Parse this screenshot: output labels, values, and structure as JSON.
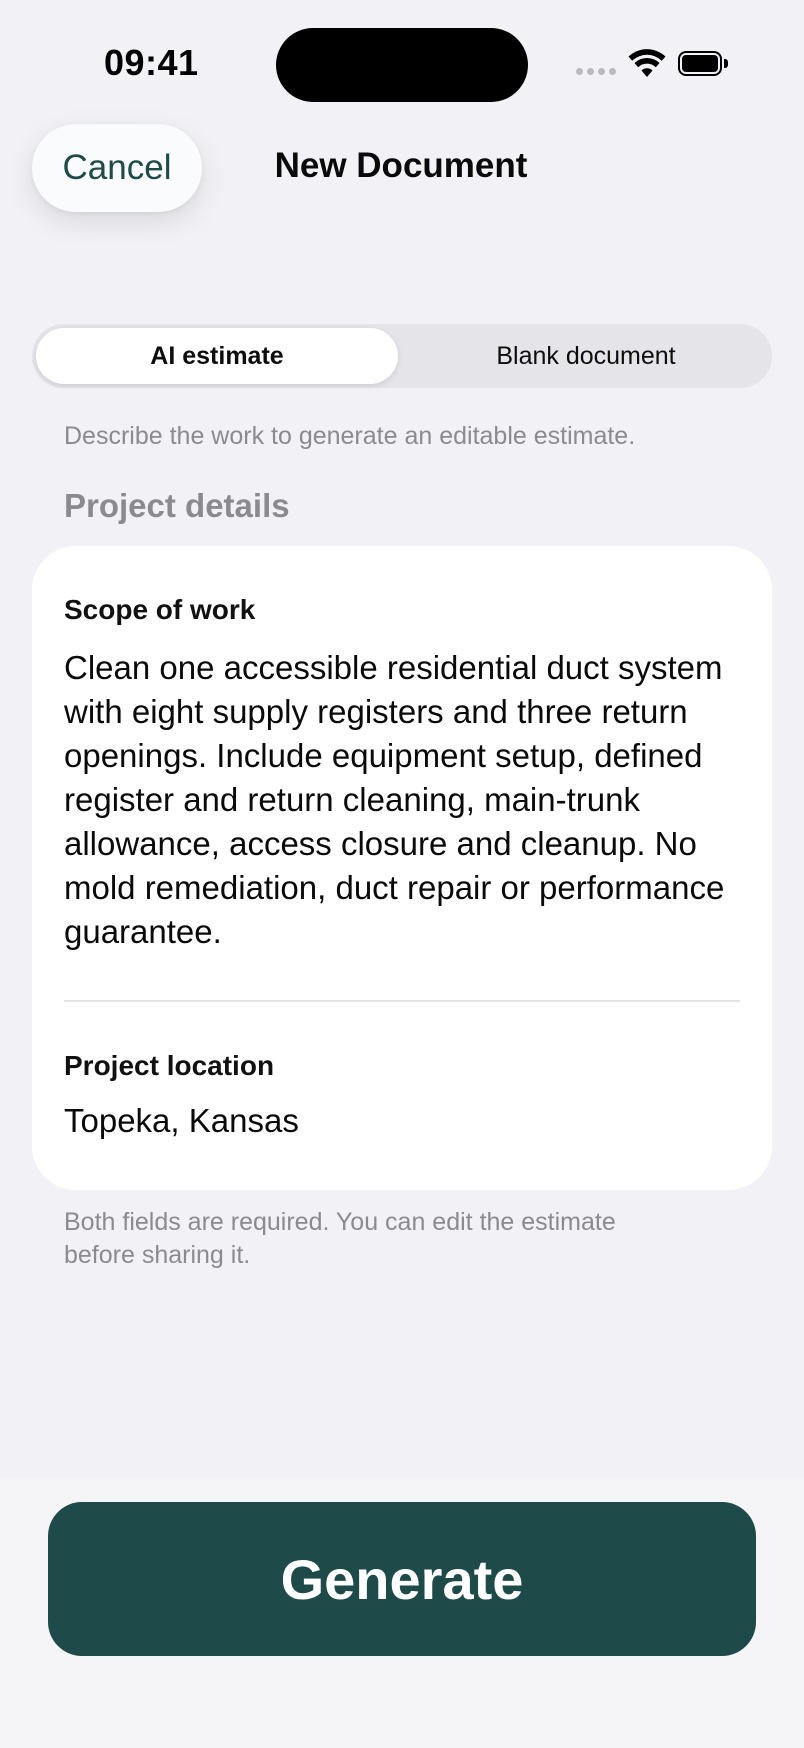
{
  "status_bar": {
    "time": "09:41"
  },
  "nav": {
    "cancel_label": "Cancel",
    "title": "New Document"
  },
  "segmented": {
    "options": [
      "AI estimate",
      "Blank document"
    ],
    "selected": "AI estimate"
  },
  "helper_text": "Describe the work to generate an editable estimate.",
  "section_title": "Project details",
  "form": {
    "scope": {
      "label": "Scope of work",
      "value": "Clean one accessible residential duct system with eight supply registers and three return openings. Include equipment setup, defined register and return cleaning, main-trunk allowance, access closure and cleanup. No mold remediation, duct repair or performance guarantee."
    },
    "location": {
      "label": "Project location",
      "value": "Topeka, Kansas"
    }
  },
  "footnote": "Both fields are required. You can edit the estimate before sharing it.",
  "generate_label": "Generate",
  "colors": {
    "accent": "#1e4a49",
    "background": "#f2f2f6",
    "secondary_text": "#8a8a8f"
  },
  "icons": [
    "signal-icon",
    "wifi-icon",
    "battery-icon"
  ]
}
